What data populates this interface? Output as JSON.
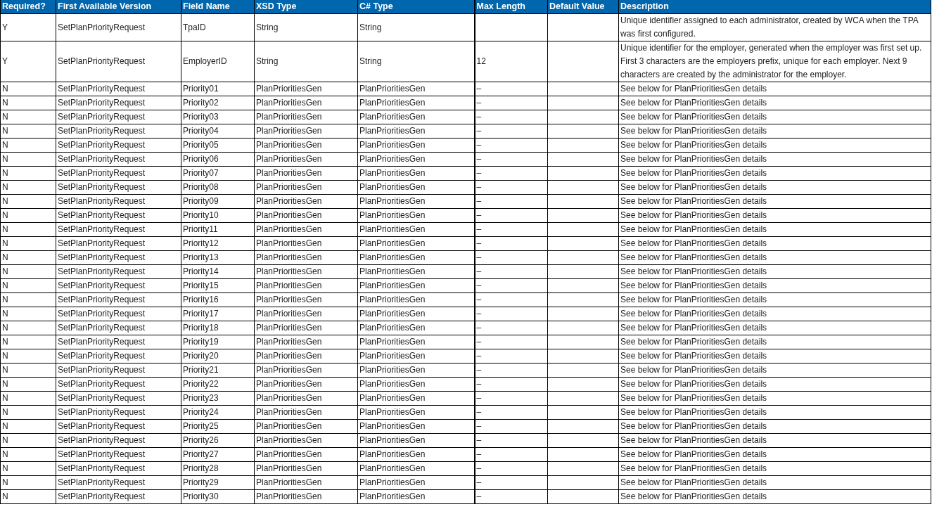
{
  "table": {
    "columns": [
      "Required?",
      "First Available Version",
      "Field Name",
      "XSD Type",
      "C# Type",
      "Max Length",
      "Default Value",
      "Description"
    ],
    "rows": [
      {
        "required": "Y",
        "version": "SetPlanPriorityRequest",
        "field_name": "TpaID",
        "xsd_type": "String",
        "csharp_type": "String",
        "description": "Unique identifier assigned to each administrator, created by WCA when the TPA was first configured."
      },
      {
        "required": "Y",
        "version": "SetPlanPriorityRequest",
        "field_name": "EmployerID",
        "xsd_type": "String",
        "csharp_type": "String",
        "max_length": "12",
        "description": "Unique identifier for the employer, generated when the employer was first set up.  First 3 characters are the employers prefix, unique for each employer. Next 9 characters are created by the administrator for the employer."
      },
      {
        "required": "N",
        "version": "SetPlanPriorityRequest",
        "field_name": "Priority01",
        "xsd_type": "PlanPrioritiesGen",
        "csharp_type": "PlanPrioritiesGen",
        "max_length": "–",
        "description": "See below for PlanPrioritiesGen details"
      },
      {
        "required": "N",
        "version": "SetPlanPriorityRequest",
        "field_name": "Priority02",
        "xsd_type": "PlanPrioritiesGen",
        "csharp_type": "PlanPrioritiesGen",
        "max_length": "–",
        "description": "See below for PlanPrioritiesGen details"
      },
      {
        "required": "N",
        "version": "SetPlanPriorityRequest",
        "field_name": "Priority03",
        "xsd_type": "PlanPrioritiesGen",
        "csharp_type": "PlanPrioritiesGen",
        "max_length": "–",
        "description": "See below for PlanPrioritiesGen details"
      },
      {
        "required": "N",
        "version": "SetPlanPriorityRequest",
        "field_name": "Priority04",
        "xsd_type": "PlanPrioritiesGen",
        "csharp_type": "PlanPrioritiesGen",
        "max_length": "–",
        "description": "See below for PlanPrioritiesGen details"
      },
      {
        "required": "N",
        "version": "SetPlanPriorityRequest",
        "field_name": "Priority05",
        "xsd_type": "PlanPrioritiesGen",
        "csharp_type": "PlanPrioritiesGen",
        "max_length": "–",
        "description": "See below for PlanPrioritiesGen details"
      },
      {
        "required": "N",
        "version": "SetPlanPriorityRequest",
        "field_name": "Priority06",
        "xsd_type": "PlanPrioritiesGen",
        "csharp_type": "PlanPrioritiesGen",
        "max_length": "–",
        "description": "See below for PlanPrioritiesGen details"
      },
      {
        "required": "N",
        "version": "SetPlanPriorityRequest",
        "field_name": "Priority07",
        "xsd_type": "PlanPrioritiesGen",
        "csharp_type": "PlanPrioritiesGen",
        "max_length": "–",
        "description": "See below for PlanPrioritiesGen details"
      },
      {
        "required": "N",
        "version": "SetPlanPriorityRequest",
        "field_name": "Priority08",
        "xsd_type": "PlanPrioritiesGen",
        "csharp_type": "PlanPrioritiesGen",
        "max_length": "–",
        "description": "See below for PlanPrioritiesGen details"
      },
      {
        "required": "N",
        "version": "SetPlanPriorityRequest",
        "field_name": "Priority09",
        "xsd_type": "PlanPrioritiesGen",
        "csharp_type": "PlanPrioritiesGen",
        "max_length": "–",
        "description": "See below for PlanPrioritiesGen details"
      },
      {
        "required": "N",
        "version": "SetPlanPriorityRequest",
        "field_name": "Priority10",
        "xsd_type": "PlanPrioritiesGen",
        "csharp_type": "PlanPrioritiesGen",
        "max_length": "–",
        "description": "See below for PlanPrioritiesGen details"
      },
      {
        "required": "N",
        "version": "SetPlanPriorityRequest",
        "field_name": "Priority11",
        "xsd_type": "PlanPrioritiesGen",
        "csharp_type": "PlanPrioritiesGen",
        "max_length": "–",
        "description": "See below for PlanPrioritiesGen details"
      },
      {
        "required": "N",
        "version": "SetPlanPriorityRequest",
        "field_name": "Priority12",
        "xsd_type": "PlanPrioritiesGen",
        "csharp_type": "PlanPrioritiesGen",
        "max_length": "–",
        "description": "See below for PlanPrioritiesGen details"
      },
      {
        "required": "N",
        "version": "SetPlanPriorityRequest",
        "field_name": "Priority13",
        "xsd_type": "PlanPrioritiesGen",
        "csharp_type": "PlanPrioritiesGen",
        "max_length": "–",
        "description": "See below for PlanPrioritiesGen details"
      },
      {
        "required": "N",
        "version": "SetPlanPriorityRequest",
        "field_name": "Priority14",
        "xsd_type": "PlanPrioritiesGen",
        "csharp_type": "PlanPrioritiesGen",
        "max_length": "–",
        "description": "See below for PlanPrioritiesGen details"
      },
      {
        "required": "N",
        "version": "SetPlanPriorityRequest",
        "field_name": "Priority15",
        "xsd_type": "PlanPrioritiesGen",
        "csharp_type": "PlanPrioritiesGen",
        "max_length": "–",
        "description": "See below for PlanPrioritiesGen details"
      },
      {
        "required": "N",
        "version": "SetPlanPriorityRequest",
        "field_name": "Priority16",
        "xsd_type": "PlanPrioritiesGen",
        "csharp_type": "PlanPrioritiesGen",
        "max_length": "–",
        "description": "See below for PlanPrioritiesGen details"
      },
      {
        "required": "N",
        "version": "SetPlanPriorityRequest",
        "field_name": "Priority17",
        "xsd_type": "PlanPrioritiesGen",
        "csharp_type": "PlanPrioritiesGen",
        "max_length": "–",
        "description": "See below for PlanPrioritiesGen details"
      },
      {
        "required": "N",
        "version": "SetPlanPriorityRequest",
        "field_name": "Priority18",
        "xsd_type": "PlanPrioritiesGen",
        "csharp_type": "PlanPrioritiesGen",
        "max_length": "–",
        "description": "See below for PlanPrioritiesGen details"
      },
      {
        "required": "N",
        "version": "SetPlanPriorityRequest",
        "field_name": "Priority19",
        "xsd_type": "PlanPrioritiesGen",
        "csharp_type": "PlanPrioritiesGen",
        "max_length": "–",
        "description": "See below for PlanPrioritiesGen details"
      },
      {
        "required": "N",
        "version": "SetPlanPriorityRequest",
        "field_name": "Priority20",
        "xsd_type": "PlanPrioritiesGen",
        "csharp_type": "PlanPrioritiesGen",
        "max_length": "–",
        "description": "See below for PlanPrioritiesGen details"
      },
      {
        "required": "N",
        "version": "SetPlanPriorityRequest",
        "field_name": "Priority21",
        "xsd_type": "PlanPrioritiesGen",
        "csharp_type": "PlanPrioritiesGen",
        "max_length": "–",
        "description": "See below for PlanPrioritiesGen details"
      },
      {
        "required": "N",
        "version": "SetPlanPriorityRequest",
        "field_name": "Priority22",
        "xsd_type": "PlanPrioritiesGen",
        "csharp_type": "PlanPrioritiesGen",
        "max_length": "–",
        "description": "See below for PlanPrioritiesGen details"
      },
      {
        "required": "N",
        "version": "SetPlanPriorityRequest",
        "field_name": "Priority23",
        "xsd_type": "PlanPrioritiesGen",
        "csharp_type": "PlanPrioritiesGen",
        "max_length": "–",
        "description": "See below for PlanPrioritiesGen details"
      },
      {
        "required": "N",
        "version": "SetPlanPriorityRequest",
        "field_name": "Priority24",
        "xsd_type": "PlanPrioritiesGen",
        "csharp_type": "PlanPrioritiesGen",
        "max_length": "–",
        "description": "See below for PlanPrioritiesGen details"
      },
      {
        "required": "N",
        "version": "SetPlanPriorityRequest",
        "field_name": "Priority25",
        "xsd_type": "PlanPrioritiesGen",
        "csharp_type": "PlanPrioritiesGen",
        "max_length": "–",
        "description": "See below for PlanPrioritiesGen details"
      },
      {
        "required": "N",
        "version": "SetPlanPriorityRequest",
        "field_name": "Priority26",
        "xsd_type": "PlanPrioritiesGen",
        "csharp_type": "PlanPrioritiesGen",
        "max_length": "–",
        "description": "See below for PlanPrioritiesGen details"
      },
      {
        "required": "N",
        "version": "SetPlanPriorityRequest",
        "field_name": "Priority27",
        "xsd_type": "PlanPrioritiesGen",
        "csharp_type": "PlanPrioritiesGen",
        "max_length": "–",
        "description": "See below for PlanPrioritiesGen details"
      },
      {
        "required": "N",
        "version": "SetPlanPriorityRequest",
        "field_name": "Priority28",
        "xsd_type": "PlanPrioritiesGen",
        "csharp_type": "PlanPrioritiesGen",
        "max_length": "–",
        "description": "See below for PlanPrioritiesGen details"
      },
      {
        "required": "N",
        "version": "SetPlanPriorityRequest",
        "field_name": "Priority29",
        "xsd_type": "PlanPrioritiesGen",
        "csharp_type": "PlanPrioritiesGen",
        "max_length": "–",
        "description": "See below for PlanPrioritiesGen details"
      },
      {
        "required": "N",
        "version": "SetPlanPriorityRequest",
        "field_name": "Priority30",
        "xsd_type": "PlanPrioritiesGen",
        "csharp_type": "PlanPrioritiesGen",
        "max_length": "–",
        "description": "See below for PlanPrioritiesGen details"
      }
    ]
  }
}
